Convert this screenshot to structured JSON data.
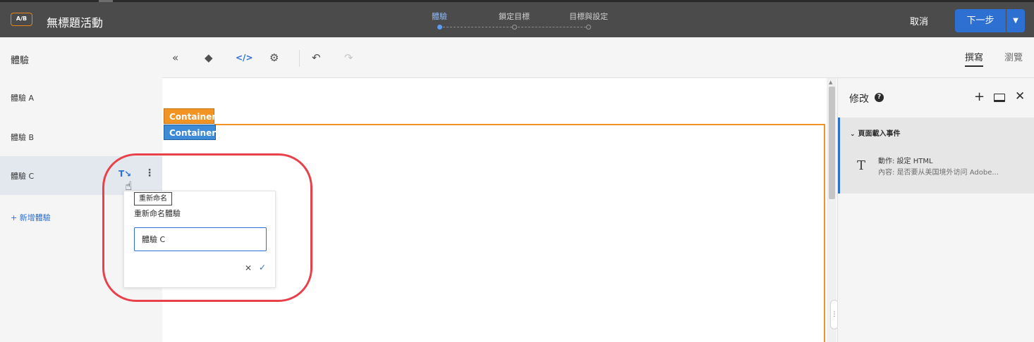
{
  "header": {
    "badge": "A/B",
    "title": "無標題活動",
    "steps": [
      {
        "label": "體驗",
        "active": true
      },
      {
        "label": "鎖定目標",
        "active": false
      },
      {
        "label": "目標與設定",
        "active": false
      }
    ],
    "cancel_label": "取消",
    "next_label": "下一步",
    "next_menu_icon": "chevron-down-icon"
  },
  "sidebar": {
    "title": "體驗",
    "experiences": [
      {
        "label": "體驗 A",
        "selected": false
      },
      {
        "label": "體驗 B",
        "selected": false
      },
      {
        "label": "體驗 C",
        "selected": true
      }
    ],
    "add_label": "+ 新增體驗"
  },
  "toolbar": {
    "icons": [
      "collapse-icon",
      "layers-icon",
      "code-icon",
      "settings-icon",
      "undo-icon",
      "redo-icon"
    ],
    "tabs": [
      {
        "label": "撰寫",
        "active": true
      },
      {
        "label": "瀏覽",
        "active": false
      }
    ]
  },
  "canvas": {
    "tags": [
      "Container",
      "Container"
    ]
  },
  "right_panel": {
    "title": "修改",
    "event_title": "頁面載入事件",
    "action_line1": "動作: 設定 HTML",
    "action_line2": "內容: 是否要从美国境外访问 Adobe..."
  },
  "rename_popover": {
    "tooltip": "重新命名",
    "label": "重新命名體驗",
    "value": "體驗 C"
  },
  "colors": {
    "accent": "#2d70d2",
    "container_orange": "#f29423",
    "container_blue": "#3d8ad6",
    "annotation_red": "#e8414b",
    "header_bg": "#4b4b4b"
  }
}
